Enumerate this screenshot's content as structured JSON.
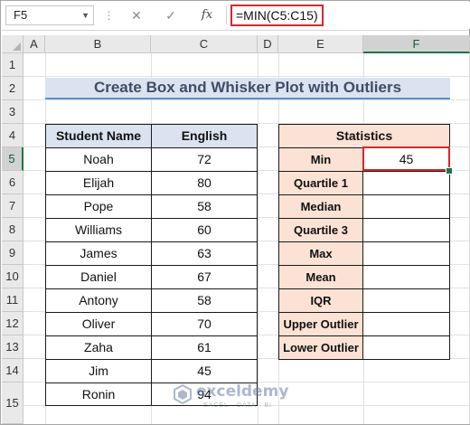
{
  "formula_bar": {
    "name_box": "F5",
    "cancel_icon": "✕",
    "enter_icon": "✓",
    "fx_label": "fx",
    "formula": "=MIN(C5:C15)"
  },
  "columns": [
    "A",
    "B",
    "C",
    "D",
    "E",
    "F"
  ],
  "selected_column": "F",
  "rows": [
    "1",
    "2",
    "3",
    "4",
    "5",
    "6",
    "7",
    "8",
    "9",
    "10",
    "11",
    "12",
    "13",
    "14",
    "15"
  ],
  "selected_row": "5",
  "title": "Create Box and Whisker Plot with Outliers",
  "students_table": {
    "headers": [
      "Student Name",
      "English"
    ],
    "rows": [
      {
        "name": "Noah",
        "score": "72"
      },
      {
        "name": "Elijah",
        "score": "80"
      },
      {
        "name": "Pope",
        "score": "58"
      },
      {
        "name": "Williams",
        "score": "60"
      },
      {
        "name": "James",
        "score": "63"
      },
      {
        "name": "Daniel",
        "score": "67"
      },
      {
        "name": "Antony",
        "score": "58"
      },
      {
        "name": "Oliver",
        "score": "70"
      },
      {
        "name": "Zaha",
        "score": "61"
      },
      {
        "name": "Jim",
        "score": "45"
      },
      {
        "name": "Ronin",
        "score": "94"
      }
    ]
  },
  "statistics_table": {
    "header": "Statistics",
    "rows": [
      {
        "label": "Min",
        "value": "45"
      },
      {
        "label": "Quartile 1",
        "value": ""
      },
      {
        "label": "Median",
        "value": ""
      },
      {
        "label": "Quartile 3",
        "value": ""
      },
      {
        "label": "Max",
        "value": ""
      },
      {
        "label": "Mean",
        "value": ""
      },
      {
        "label": "IQR",
        "value": ""
      },
      {
        "label": "Upper Outlier",
        "value": ""
      },
      {
        "label": "Lower Outlier",
        "value": ""
      }
    ]
  },
  "watermark": {
    "name": "exceldemy",
    "tagline": "EXCEL · DATA · BI"
  },
  "colors": {
    "accent_green": "#217346",
    "selection_red": "#d9262b",
    "header_blue": "#dbe3f1",
    "stats_peach": "#fbe2d5"
  }
}
